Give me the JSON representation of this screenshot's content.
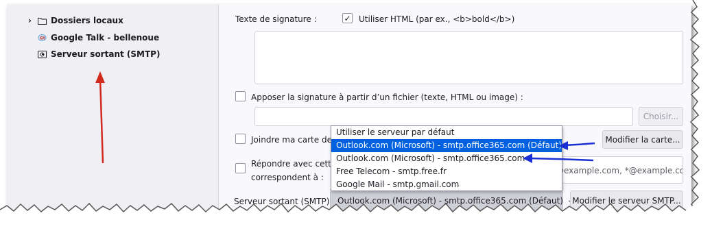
{
  "sidebar": {
    "items": [
      {
        "label": "Dossiers locaux",
        "icon": "folder-icon"
      },
      {
        "label": "Google Talk - bellenoue",
        "icon": "google-talk-icon"
      },
      {
        "label": "Serveur sortant (SMTP)",
        "icon": "outgoing-server-icon"
      }
    ]
  },
  "signature": {
    "label": "Texte de signature :",
    "use_html_label": "Utiliser HTML (par ex., <b>bold</b>)",
    "use_html_checked": true,
    "file_label": "Apposer la signature à partir d’un fichier (texte, HTML ou image) :",
    "file_choose_button": "Choisir..."
  },
  "vcard": {
    "label": "Joindre ma carte de v",
    "modify_button": "Modifier la carte..."
  },
  "reply": {
    "label_line1": "Répondre avec cette",
    "label_line2": "correspondent à :",
    "field_value": "@example.com, *@example.co"
  },
  "smtp": {
    "label": "Serveur sortant (SMTP) :",
    "selected": "Outlook.com (Microsoft) - smtp.office365.com (Défaut)",
    "modify_button": "Modifier le serveur SMTP...",
    "options": [
      "Utiliser le serveur par défaut",
      "Outlook.com (Microsoft) - smtp.office365.com (Défaut)",
      "Outlook.com (Microsoft) - smtp.office365.com",
      "Free Telecom - smtp.free.fr",
      "Google Mail - smtp.gmail.com"
    ],
    "highlighted_index": 1
  },
  "colors": {
    "annotation_red": "#d42a1e",
    "annotation_blue": "#1a2fd4",
    "selection": "#0060df"
  }
}
